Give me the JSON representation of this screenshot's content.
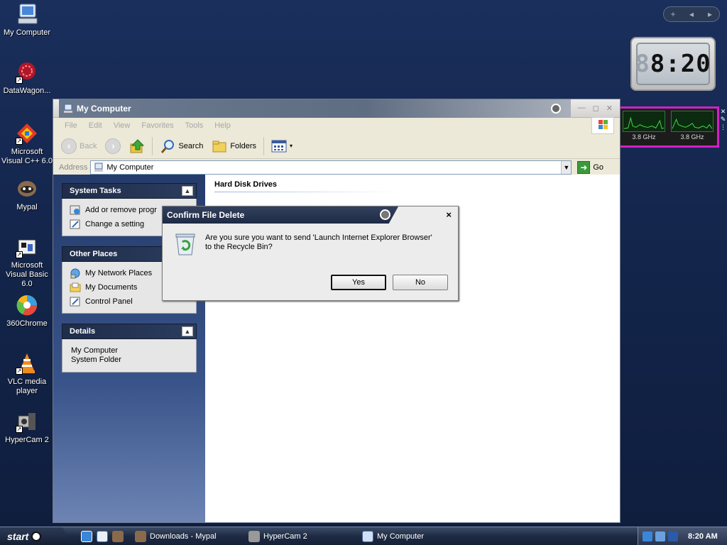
{
  "desktop": {
    "icons": [
      {
        "label": "My Computer",
        "icon": "my-computer-icon"
      },
      {
        "label": "DataWagon...",
        "icon": "datawagon-icon"
      },
      {
        "label": "Microsoft Visual C++ 6.0",
        "icon": "visual-cpp-icon"
      },
      {
        "label": "Mypal",
        "icon": "mypal-icon"
      },
      {
        "label": "Microsoft Visual Basic 6.0",
        "icon": "visual-basic-icon"
      },
      {
        "label": "360Chrome",
        "icon": "360chrome-icon"
      },
      {
        "label": "VLC media player",
        "icon": "vlc-icon"
      },
      {
        "label": "HyperCam 2",
        "icon": "hypercam-icon"
      }
    ]
  },
  "gadgets": {
    "nav": {
      "add": "+",
      "prev": "◂",
      "next": "▸"
    },
    "clock": {
      "time": "8:20",
      "leading_digit": "8"
    },
    "cpu": {
      "core1": "3.8 GHz",
      "core2": "3.8 GHz"
    },
    "side": {
      "close": "✕",
      "settings": "✎",
      "drag": "⋮"
    }
  },
  "window": {
    "title": "My Computer",
    "menu": [
      "File",
      "Edit",
      "View",
      "Favorites",
      "Tools",
      "Help"
    ],
    "toolbar": {
      "back": "Back",
      "search": "Search",
      "folders": "Folders"
    },
    "address": {
      "label": "Address",
      "value": "My Computer",
      "go": "Go"
    },
    "panels": {
      "system_tasks": {
        "title": "System Tasks",
        "items": [
          "Add or remove progr",
          "Change a setting"
        ]
      },
      "other_places": {
        "title": "Other Places",
        "items": [
          "My Network Places",
          "My Documents",
          "Control Panel"
        ]
      },
      "details": {
        "title": "Details",
        "line1": "My Computer",
        "line2": "System Folder"
      }
    },
    "content": {
      "section": "Hard Disk Drives"
    }
  },
  "dialog": {
    "title": "Confirm File Delete",
    "message_line1": "Are you sure you want to send 'Launch Internet Explorer Browser'",
    "message_line2": "to the Recycle Bin?",
    "yes": "Yes",
    "no": "No",
    "close": "×"
  },
  "taskbar": {
    "start": "start",
    "tasks": [
      {
        "label": "Downloads - Mypal"
      },
      {
        "label": "HyperCam 2"
      },
      {
        "label": "My Computer"
      }
    ],
    "time": "8:20 AM"
  },
  "colors": {
    "desktop": "#16294f",
    "sidebar_highlight": "#d21fc7",
    "task_pane": "#2b416f",
    "title_band": "#6b7a90"
  }
}
